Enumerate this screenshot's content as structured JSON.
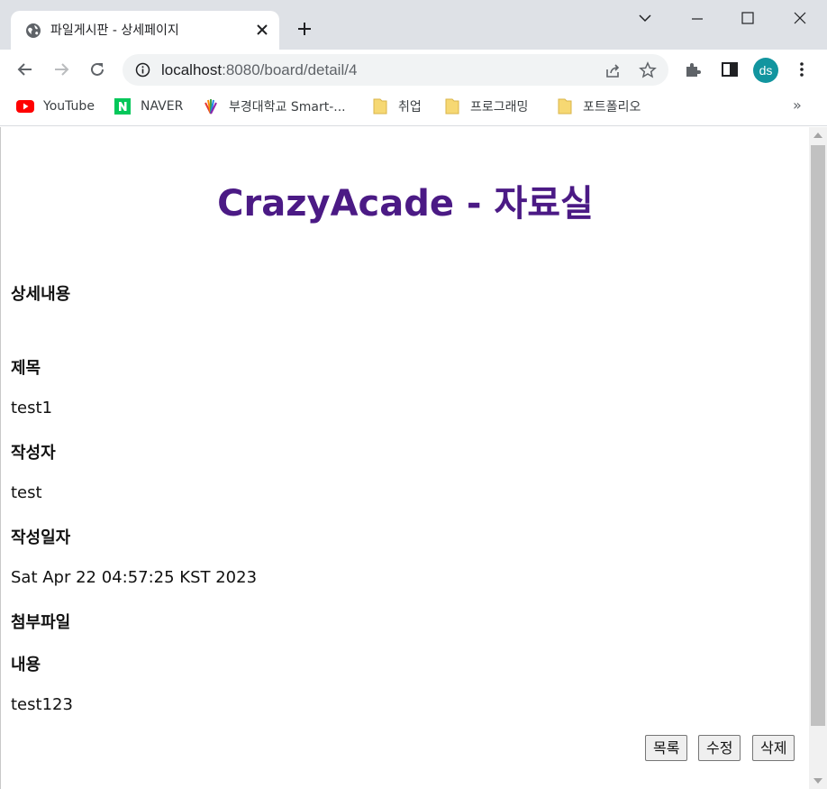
{
  "browser": {
    "tab_title": "파일게시판 - 상세페이지",
    "url_host": "localhost",
    "url_rest": ":8080/board/detail/4",
    "profile_initials": "ds",
    "bookmarks": [
      {
        "label": "YouTube",
        "icon": "youtube-icon"
      },
      {
        "label": "NAVER",
        "icon": "naver-icon"
      },
      {
        "label": "부경대학교 Smart-...",
        "icon": "pknu-icon"
      },
      {
        "label": "취업",
        "icon": "folder-icon"
      },
      {
        "label": "프로그래밍",
        "icon": "folder-icon"
      },
      {
        "label": "포트폴리오",
        "icon": "folder-icon"
      }
    ],
    "bookmarks_more": "»",
    "colors": {
      "tabstrip": "#dee1e6",
      "avatar": "#12959f"
    }
  },
  "page": {
    "title": "CrazyAcade - 자료실",
    "title_color": "#4b1a85",
    "section_heading": "상세내용",
    "fields": {
      "subject_label": "제목",
      "subject_value": "test1",
      "author_label": "작성자",
      "author_value": "test",
      "date_label": "작성일자",
      "date_value": "Sat Apr 22 04:57:25 KST 2023",
      "attachment_label": "첨부파일",
      "content_label": "내용",
      "content_value": "test123"
    },
    "buttons": {
      "list": "목록",
      "edit": "수정",
      "delete": "삭제"
    }
  }
}
